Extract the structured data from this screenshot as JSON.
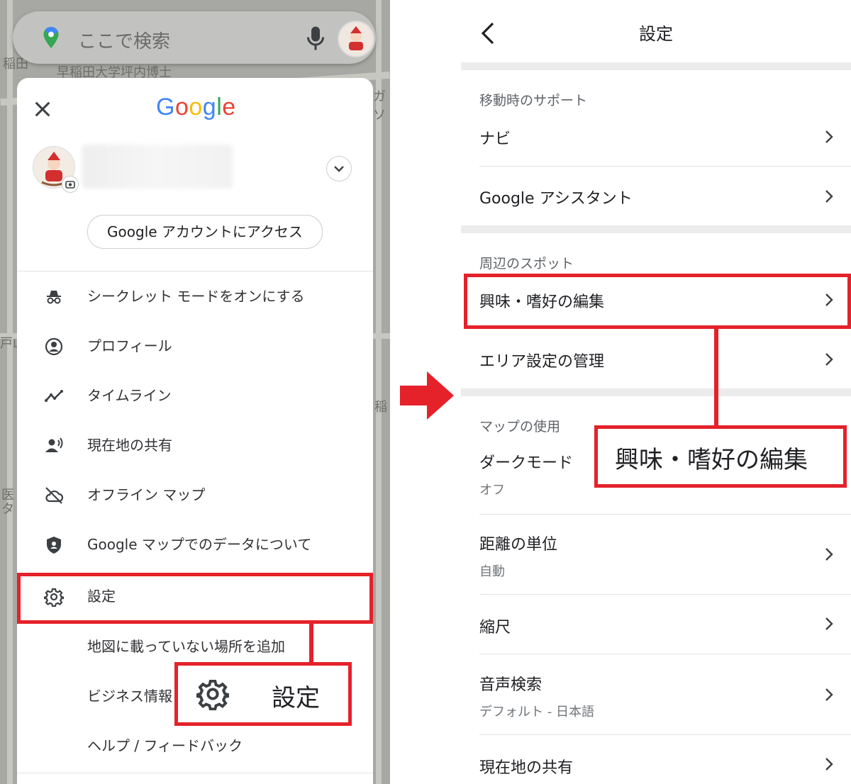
{
  "left": {
    "search": {
      "placeholder": "ここで検索"
    },
    "map_labels": [
      "稲田",
      "早稲田大学坪内博士",
      "ガソ",
      "戸山",
      "稲",
      "医",
      "タ"
    ],
    "google_logo": {
      "letters": [
        "G",
        "o",
        "o",
        "g",
        "l",
        "e"
      ],
      "colors": [
        "#4285F4",
        "#EA4335",
        "#FBBC05",
        "#4285F4",
        "#34A853",
        "#EA4335"
      ]
    },
    "account_button": "Google アカウントにアクセス",
    "menu": [
      {
        "icon": "incognito-icon",
        "label": "シークレット モードをオンにする"
      },
      {
        "icon": "profile-icon",
        "label": "プロフィール"
      },
      {
        "icon": "timeline-icon",
        "label": "タイムライン"
      },
      {
        "icon": "location-sharing-icon",
        "label": "現在地の共有"
      },
      {
        "icon": "offline-cloud-icon",
        "label": "オフライン マップ"
      },
      {
        "icon": "shield-icon",
        "label": "Google マップでのデータについて"
      },
      {
        "icon": "gear-icon",
        "label": "設定"
      },
      {
        "icon": "",
        "label": "地図に載っていない場所を追加"
      },
      {
        "icon": "",
        "label": "ビジネス情報"
      },
      {
        "icon": "",
        "label": "ヘルプ / フィードバック"
      }
    ],
    "callout_label": "設定"
  },
  "right": {
    "title": "設定",
    "sections": [
      {
        "header": "移動時のサポート",
        "rows": [
          {
            "label": "ナビ"
          },
          {
            "label": "Google アシスタント"
          }
        ]
      },
      {
        "header": "周辺のスポット",
        "rows": [
          {
            "label": "興味・嗜好の編集"
          },
          {
            "label": "エリア設定の管理"
          }
        ]
      },
      {
        "header": "マップの使用",
        "rows": [
          {
            "label": "ダークモード",
            "sub": "オフ"
          },
          {
            "label": "距離の単位",
            "sub": "自動"
          },
          {
            "label": "縮尺"
          },
          {
            "label": "音声検索",
            "sub": "デフォルト - 日本語"
          },
          {
            "label": "現在地の共有"
          }
        ]
      }
    ],
    "callout_label": "興味・嗜好の編集"
  },
  "colors": {
    "highlight_red": "#e5212a",
    "arrow_red": "#e5212a"
  }
}
